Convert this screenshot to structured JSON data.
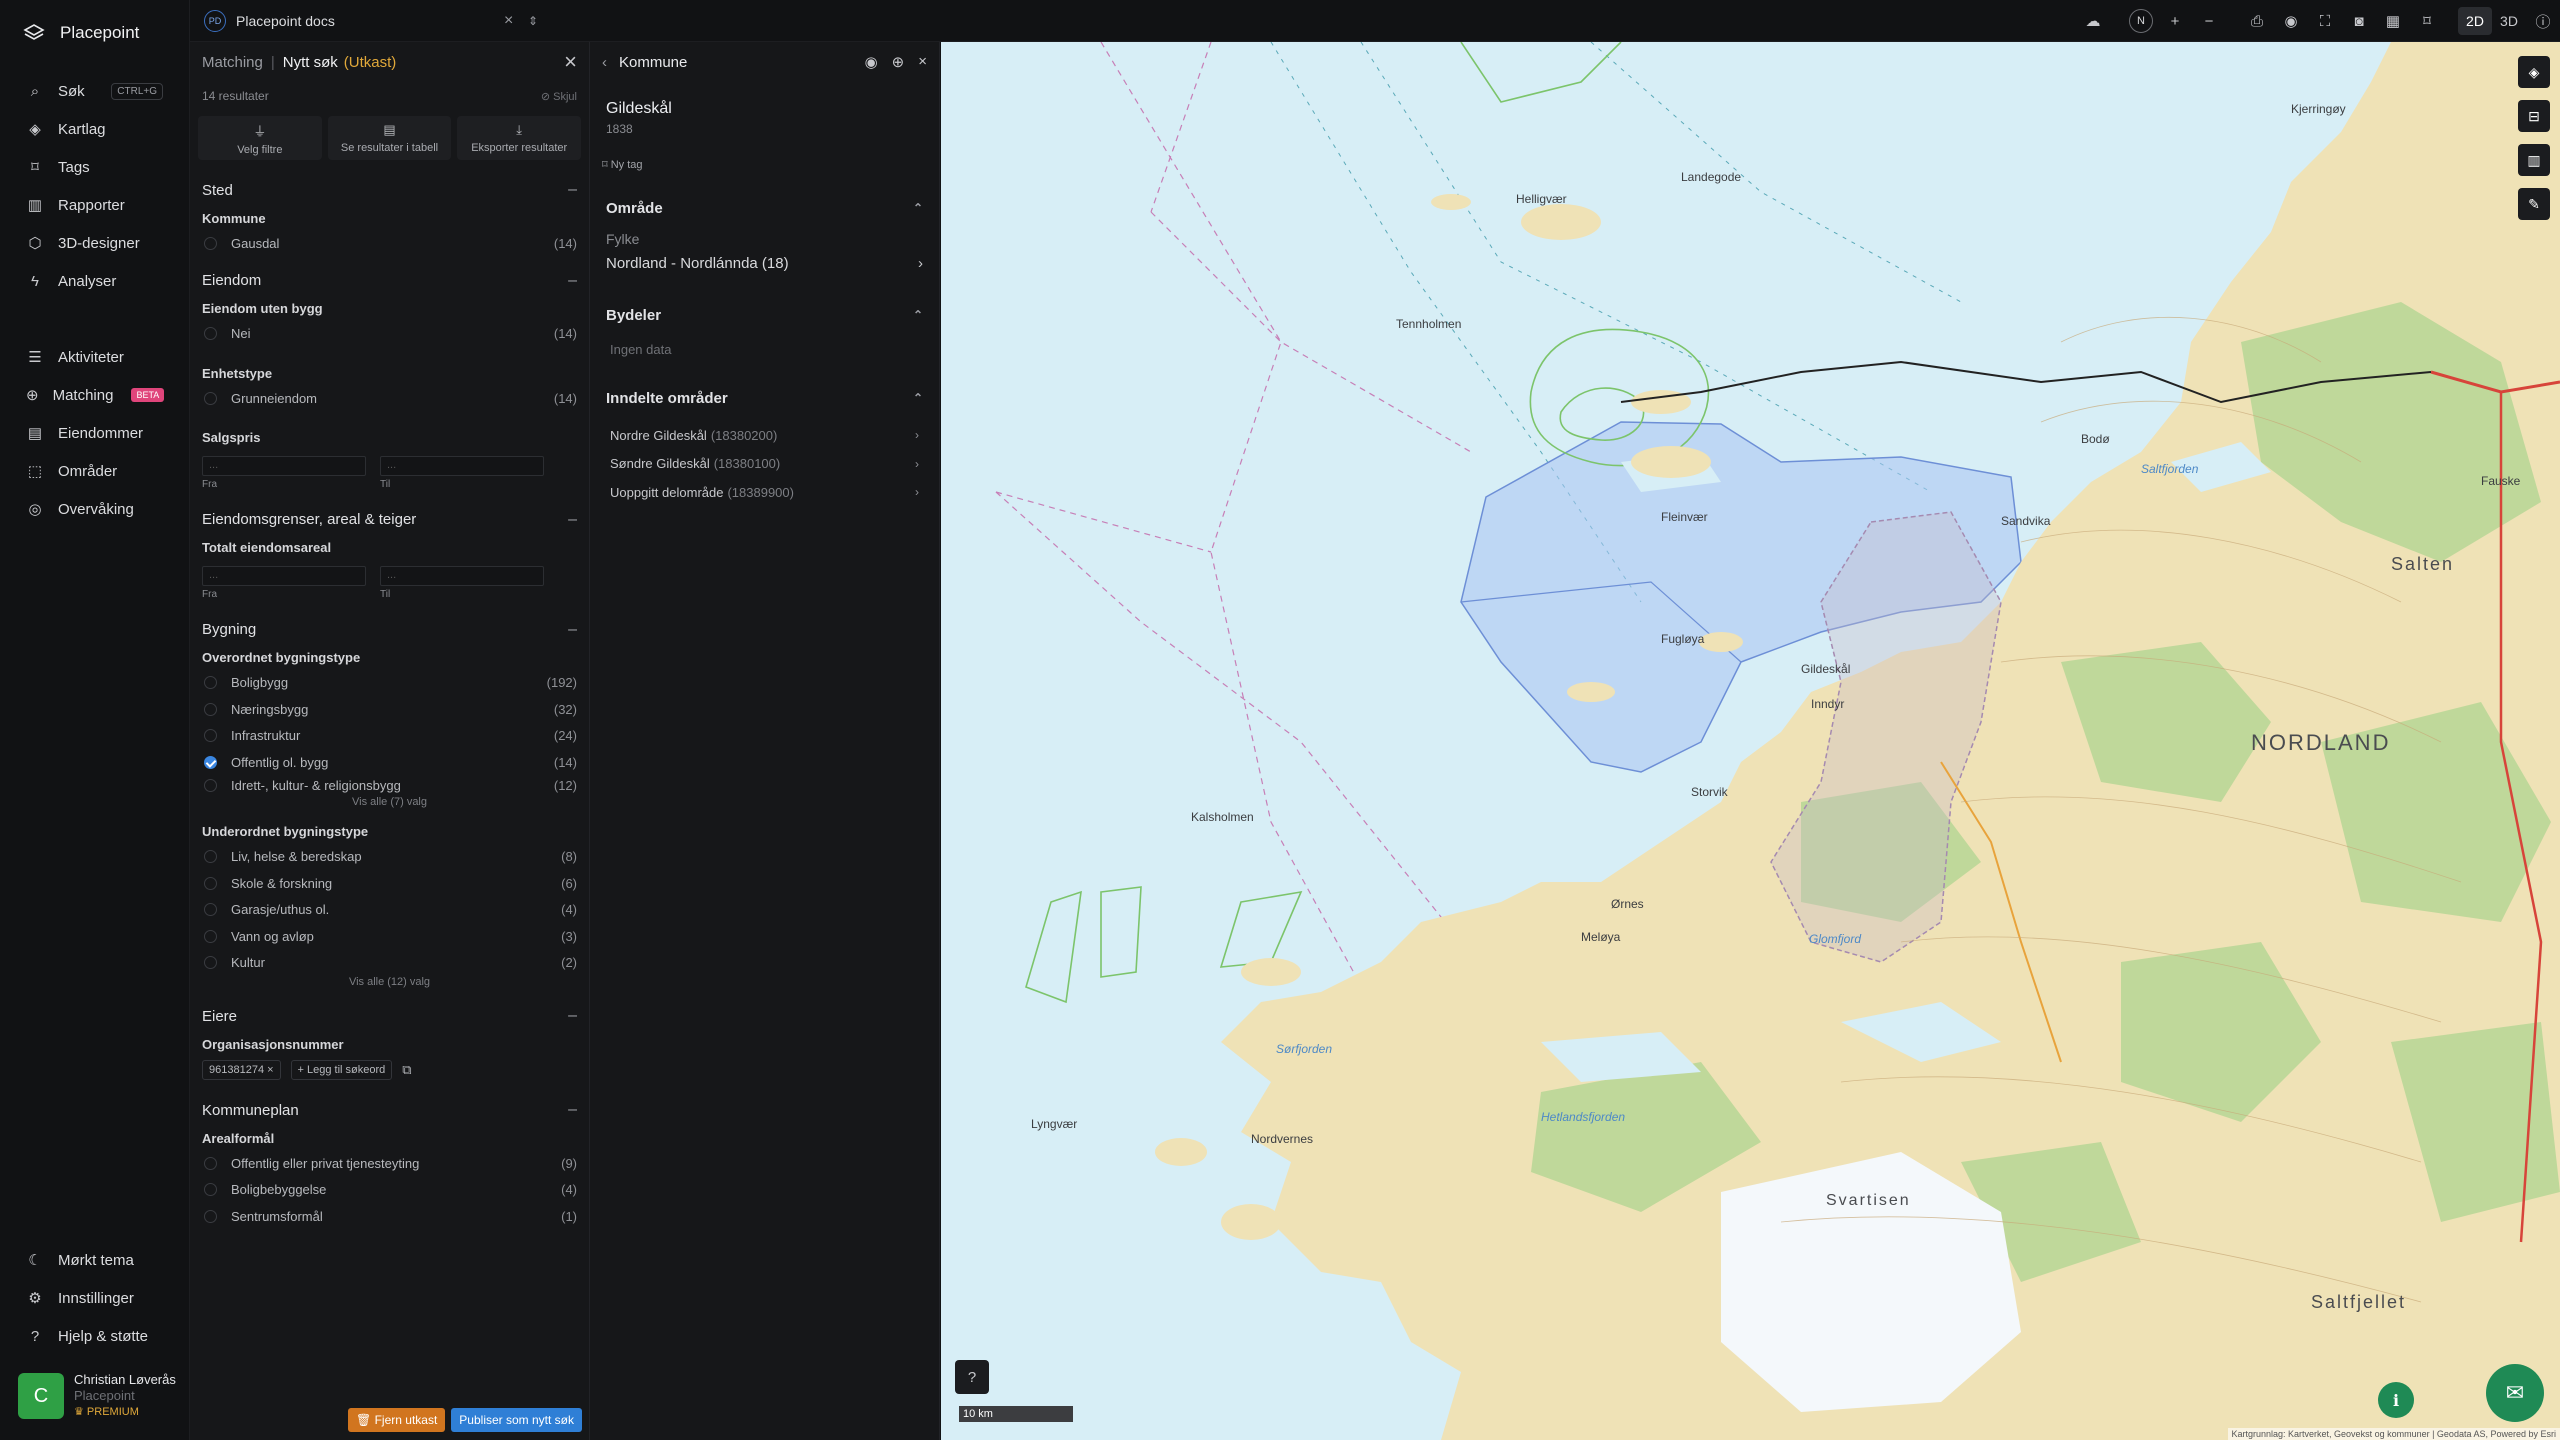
{
  "app": {
    "name": "Placepoint"
  },
  "sidebar": {
    "items": [
      {
        "label": "Søk",
        "icon": "search-icon",
        "shortcut": "CTRL+G"
      },
      {
        "label": "Kartlag",
        "icon": "layers-icon"
      },
      {
        "label": "Tags",
        "icon": "bookmark-icon"
      },
      {
        "label": "Rapporter",
        "icon": "chart-icon"
      },
      {
        "label": "3D-designer",
        "icon": "cube-icon"
      },
      {
        "label": "Analyser",
        "icon": "bolt-icon"
      },
      {
        "label": "Aktiviteter",
        "icon": "activity-icon"
      },
      {
        "label": "Matching",
        "icon": "matching-icon",
        "badge": "BETA"
      },
      {
        "label": "Eiendommer",
        "icon": "building-icon"
      },
      {
        "label": "Områder",
        "icon": "area-icon"
      },
      {
        "label": "Overvåking",
        "icon": "monitor-icon"
      }
    ],
    "bottom": [
      {
        "label": "Mørkt tema",
        "icon": "moon-icon"
      },
      {
        "label": "Innstillinger",
        "icon": "gear-icon"
      },
      {
        "label": "Hjelp & støtte",
        "icon": "help-icon"
      }
    ],
    "user": {
      "initial": "C",
      "name": "Christian Løverås",
      "org": "Placepoint",
      "plan": "PREMIUM"
    }
  },
  "topbar": {
    "project_initials": "PD",
    "project_name": "Placepoint docs",
    "mode_2d": "2D",
    "mode_3d": "3D",
    "north": "N"
  },
  "matching": {
    "crumb": "Matching",
    "title": "Nytt søk",
    "status": "(Utkast)",
    "results": "14 resultater",
    "hide": "Skjul",
    "actions": [
      "Velg filtre",
      "Se resultater i tabell",
      "Eksporter resultater"
    ],
    "sections": {
      "sted": {
        "title": "Sted",
        "kommune_label": "Kommune",
        "options": [
          {
            "label": "Gausdal",
            "count": "(14)"
          }
        ]
      },
      "eiendom": {
        "title": "Eiendom",
        "uten_bygg_label": "Eiendom uten bygg",
        "uten_bygg": [
          {
            "label": "Nei",
            "count": "(14)"
          }
        ],
        "enhetstype_label": "Enhetstype",
        "enhetstype": [
          {
            "label": "Grunneiendom",
            "count": "(14)"
          }
        ],
        "salgspris_label": "Salgspris",
        "from": "Fra",
        "to": "Til",
        "placeholder": "..."
      },
      "grenser": {
        "title": "Eiendomsgrenser, areal & teiger",
        "areal_label": "Totalt eiendomsareal"
      },
      "bygning": {
        "title": "Bygning",
        "overordnet_label": "Overordnet bygningstype",
        "overordnet": [
          {
            "label": "Boligbygg",
            "count": "(192)",
            "checked": false
          },
          {
            "label": "Næringsbygg",
            "count": "(32)",
            "checked": false
          },
          {
            "label": "Infrastruktur",
            "count": "(24)",
            "checked": false
          },
          {
            "label": "Offentlig ol. bygg",
            "count": "(14)",
            "checked": true
          },
          {
            "label": "Idrett-, kultur- & religionsbygg",
            "count": "(12)",
            "checked": false
          }
        ],
        "overordnet_showall": "Vis alle (7) valg",
        "underordnet_label": "Underordnet bygningstype",
        "underordnet": [
          {
            "label": "Liv, helse & beredskap",
            "count": "(8)"
          },
          {
            "label": "Skole & forskning",
            "count": "(6)"
          },
          {
            "label": "Garasje/uthus ol.",
            "count": "(4)"
          },
          {
            "label": "Vann og avløp",
            "count": "(3)"
          },
          {
            "label": "Kultur",
            "count": "(2)"
          }
        ],
        "underordnet_showall": "Vis alle (12) valg"
      },
      "eiere": {
        "title": "Eiere",
        "org_label": "Organisasjonsnummer",
        "org_chip": "961381274",
        "add_label": "Legg til søkeord"
      },
      "kommuneplan": {
        "title": "Kommuneplan",
        "areal_label": "Arealformål",
        "options": [
          {
            "label": "Offentlig eller privat tjenesteyting",
            "count": "(9)"
          },
          {
            "label": "Boligbebyggelse",
            "count": "(4)"
          },
          {
            "label": "Sentrumsformål",
            "count": "(1)"
          }
        ]
      }
    },
    "footer": {
      "delete": "Fjern utkast",
      "publish": "Publiser som nytt søk"
    }
  },
  "kommune": {
    "header": "Kommune",
    "name": "Gildeskål",
    "number": "1838",
    "tag": "Ny tag",
    "omrade": {
      "title": "Område",
      "fylke_label": "Fylke",
      "fylke_value": "Nordland - Nordlánnda (18)"
    },
    "bydeler": {
      "title": "Bydeler",
      "empty": "Ingen data"
    },
    "inndelte": {
      "title": "Inndelte områder",
      "items": [
        {
          "name": "Nordre Gildeskål",
          "code": "(18380200)"
        },
        {
          "name": "Søndre Gildeskål",
          "code": "(18380100)"
        },
        {
          "name": "Uoppgitt delområde",
          "code": "(18389900)"
        }
      ]
    }
  },
  "map": {
    "scale": "10 km",
    "attribution": "Kartgrunnlag: Kartverket, Geovekst og kommuner | Geodata AS, Powered by Esri",
    "labels": [
      "NORDLAND",
      "Salten",
      "Bodø",
      "Tennholmen",
      "Kalsholmen",
      "Helligvær",
      "Landegode",
      "Fleinvær",
      "Sandvika",
      "Storvik",
      "Inndyr",
      "Gildeskål",
      "Ørnes",
      "Saltfjorden",
      "Saltfjellet",
      "Svartisen",
      "Lyngvær",
      "Meløya",
      "Fugløya",
      "Nordvernes",
      "Glomfjord",
      "Hetlandsfjorden",
      "Sørfjorden",
      "Kjerringøy",
      "Fauske"
    ]
  },
  "colors": {
    "accent": "#2f7fd6",
    "draft": "#e0a83a",
    "sea": "#d7eef6",
    "land": "#efe2b6",
    "forest": "#bfd89a",
    "polygon": "#a9c4f2"
  }
}
